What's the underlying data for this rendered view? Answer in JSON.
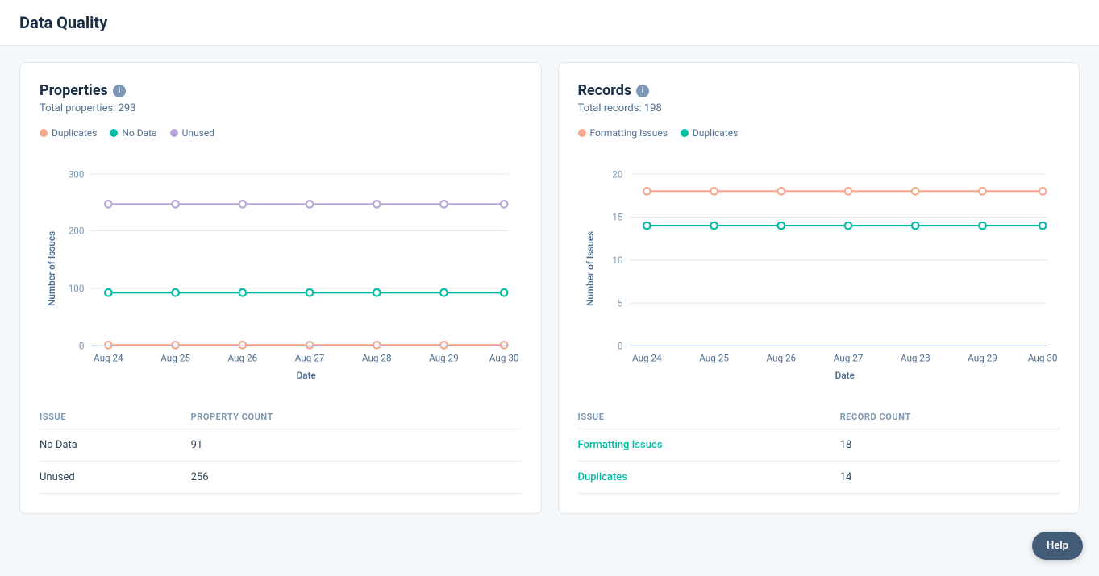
{
  "page": {
    "title": "Data Quality"
  },
  "properties_card": {
    "title": "Properties",
    "subtitle": "Total properties: 293",
    "legend": [
      {
        "label": "Duplicates",
        "color": "#f5a88e",
        "id": "duplicates"
      },
      {
        "label": "No Data",
        "color": "#00bda5",
        "id": "no-data"
      },
      {
        "label": "Unused",
        "color": "#b7a6d6",
        "id": "unused"
      }
    ],
    "chart": {
      "y_axis_label": "Number of Issues",
      "x_axis_label": "Date",
      "y_ticks": [
        "0",
        "100",
        "200",
        "300"
      ],
      "x_ticks": [
        "Aug 24",
        "Aug 25",
        "Aug 26",
        "Aug 27",
        "Aug 28",
        "Aug 29",
        "Aug 30"
      ],
      "series": {
        "unused": {
          "color": "#b7a6d6",
          "values": [
            248,
            248,
            248,
            248,
            248,
            248,
            248
          ]
        },
        "no_data": {
          "color": "#00bda5",
          "values": [
            93,
            93,
            93,
            93,
            93,
            93,
            93
          ]
        },
        "duplicates": {
          "color": "#f5a88e",
          "values": [
            1,
            1,
            1,
            1,
            1,
            1,
            1
          ]
        }
      }
    },
    "table": {
      "col1": "ISSUE",
      "col2": "PROPERTY COUNT",
      "rows": [
        {
          "issue": "No Data",
          "count": "91",
          "link": false
        },
        {
          "issue": "Unused",
          "count": "256",
          "link": false
        }
      ]
    }
  },
  "records_card": {
    "title": "Records",
    "subtitle": "Total records: 198",
    "legend": [
      {
        "label": "Formatting Issues",
        "color": "#f5a88e",
        "id": "formatting"
      },
      {
        "label": "Duplicates",
        "color": "#00bda5",
        "id": "duplicates"
      }
    ],
    "chart": {
      "y_axis_label": "Number of Issues",
      "x_axis_label": "Date",
      "y_ticks": [
        "0",
        "5",
        "10",
        "15",
        "20"
      ],
      "x_ticks": [
        "Aug 24",
        "Aug 25",
        "Aug 26",
        "Aug 27",
        "Aug 28",
        "Aug 29",
        "Aug 30"
      ],
      "series": {
        "formatting": {
          "color": "#f5a88e",
          "values": [
            18,
            18,
            18,
            18,
            18,
            18,
            18
          ]
        },
        "duplicates": {
          "color": "#00bda5",
          "values": [
            14,
            14,
            14,
            14,
            14,
            14,
            14
          ]
        }
      }
    },
    "table": {
      "col1": "ISSUE",
      "col2": "RECORD COUNT",
      "rows": [
        {
          "issue": "Formatting Issues",
          "count": "18",
          "link": true
        },
        {
          "issue": "Duplicates",
          "count": "14",
          "link": true
        }
      ]
    }
  },
  "help_button": {
    "label": "Help"
  }
}
